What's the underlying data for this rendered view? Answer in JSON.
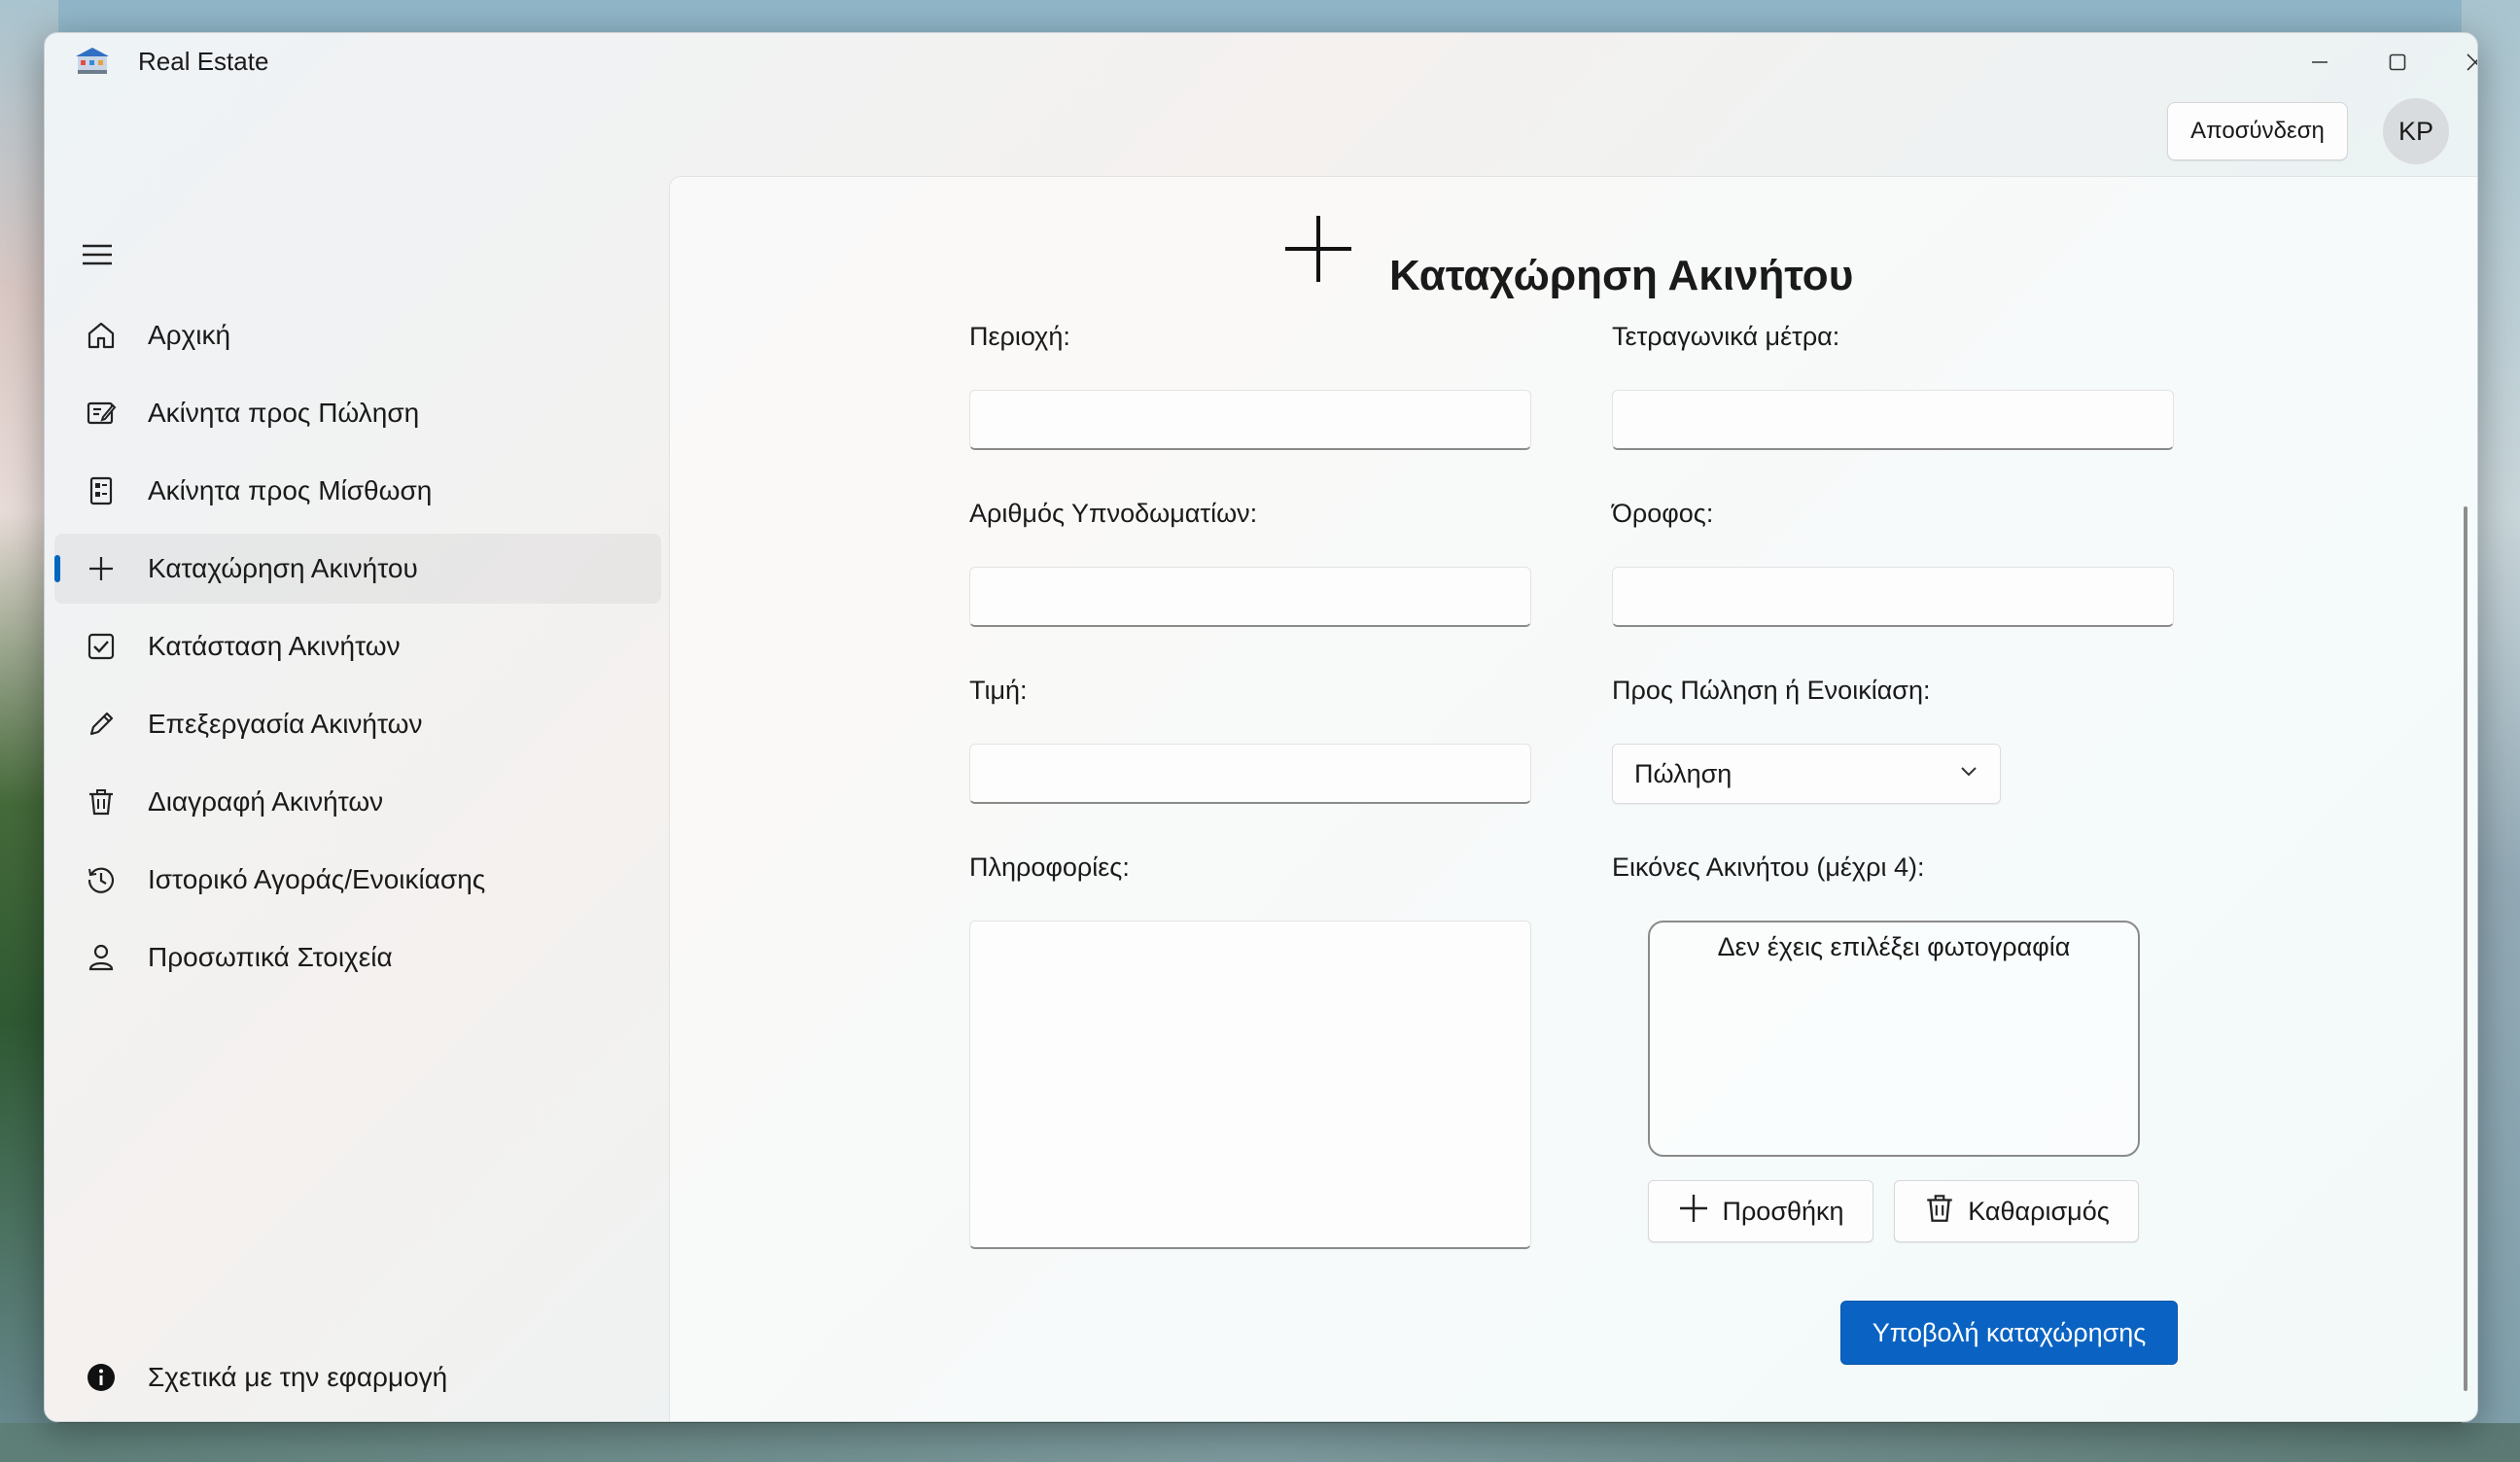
{
  "window": {
    "title": "Real Estate"
  },
  "header": {
    "logout_label": "Αποσύνδεση",
    "avatar_initials": "KP"
  },
  "sidebar": {
    "items": [
      {
        "label": "Αρχική",
        "icon": "home-icon"
      },
      {
        "label": "Ακίνητα προς Πώληση",
        "icon": "for-sale-icon"
      },
      {
        "label": "Ακίνητα προς Μίσθωση",
        "icon": "for-rent-icon"
      },
      {
        "label": "Καταχώρηση Ακινήτου",
        "icon": "plus-icon",
        "selected": true
      },
      {
        "label": "Κατάσταση Ακινήτων",
        "icon": "checkbox-icon"
      },
      {
        "label": "Επεξεργασία Ακινήτων",
        "icon": "pencil-icon"
      },
      {
        "label": "Διαγραφή Ακινήτων",
        "icon": "trash-icon"
      },
      {
        "label": "Ιστορικό Αγοράς/Ενοικίασης",
        "icon": "history-icon"
      },
      {
        "label": "Προσωπικά Στοιχεία",
        "icon": "person-icon"
      }
    ],
    "footer_label": "Σχετικά με την εφαρμογή",
    "accent_color": "#0067c0"
  },
  "form": {
    "title": "Καταχώρηση Ακινήτου",
    "area_label": "Περιοχή:",
    "area_value": "",
    "sqm_label": "Τετραγωνικά μέτρα:",
    "sqm_value": "",
    "bedrooms_label": "Αριθμός Υπνοδωματίων:",
    "bedrooms_value": "",
    "floor_label": "Όροφος:",
    "floor_value": "",
    "price_label": "Τιμή:",
    "price_value": "",
    "type_label": "Προς Πώληση ή Ενοικίαση:",
    "type_value": "Πώληση",
    "info_label": "Πληροφορίες:",
    "info_value": "",
    "images_label": "Εικόνες Ακινήτου (μέχρι 4):",
    "images_empty_text": "Δεν έχεις επιλέξει φωτογραφία",
    "add_label": "Προσθήκη",
    "clear_label": "Καθαρισμός",
    "submit_label": "Υποβολή καταχώρησης",
    "submit_color": "#0a63c2"
  }
}
